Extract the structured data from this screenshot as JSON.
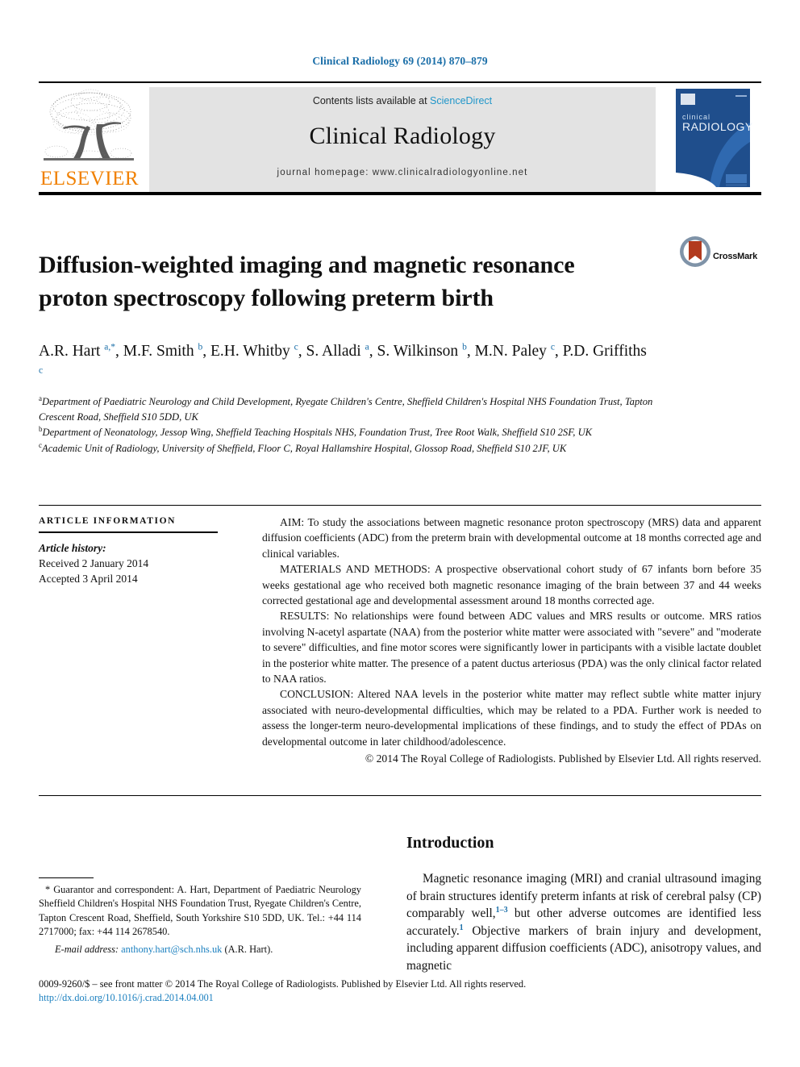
{
  "running_head": "Clinical Radiology 69 (2014) 870–879",
  "masthead": {
    "publisher_name": "ELSEVIER",
    "publisher_logo_icon": "elsevier-tree-icon",
    "contents_prefix": "Contents lists available at ",
    "contents_link": "ScienceDirect",
    "journal_name": "Clinical Radiology",
    "homepage_line": "journal homepage: www.clinicalradiologyonline.net",
    "cover_icon": "journal-cover-thumbnail",
    "cover_title_small": "clinical",
    "cover_title_large": "RADIOLOGY"
  },
  "crossmark": {
    "label": "CrossMark",
    "icon": "crossmark-badge-icon"
  },
  "article": {
    "title": "Diffusion-weighted imaging and magnetic resonance proton spectroscopy following preterm birth",
    "authors_html": "A.R. Hart <sup>a,*</sup>, M.F. Smith <sup>b</sup>, E.H. Whitby <sup>c</sup>, S. Alladi <sup>a</sup>, S. Wilkinson <sup>b</sup>, M.N. Paley <sup>c</sup>, P.D. Griffiths <sup>c</sup>",
    "affiliations": [
      {
        "marker": "a",
        "text": "Department of Paediatric Neurology and Child Development, Ryegate Children's Centre, Sheffield Children's Hospital NHS Foundation Trust, Tapton Crescent Road, Sheffield S10 5DD, UK"
      },
      {
        "marker": "b",
        "text": "Department of Neonatology, Jessop Wing, Sheffield Teaching Hospitals NHS, Foundation Trust, Tree Root Walk, Sheffield S10 2SF, UK"
      },
      {
        "marker": "c",
        "text": "Academic Unit of Radiology, University of Sheffield, Floor C, Royal Hallamshire Hospital, Glossop Road, Sheffield S10 2JF, UK"
      }
    ]
  },
  "article_info": {
    "heading": "ARTICLE INFORMATION",
    "history_label": "Article history:",
    "received": "Received 2 January 2014",
    "accepted": "Accepted 3 April 2014"
  },
  "abstract": {
    "aim": "AIM: To study the associations between magnetic resonance proton spectroscopy (MRS) data and apparent diffusion coefficients (ADC) from the preterm brain with developmental outcome at 18 months corrected age and clinical variables.",
    "methods": "MATERIALS AND METHODS: A prospective observational cohort study of 67 infants born before 35 weeks gestational age who received both magnetic resonance imaging of the brain between 37 and 44 weeks corrected gestational age and developmental assessment around 18 months corrected age.",
    "results": "RESULTS: No relationships were found between ADC values and MRS results or outcome. MRS ratios involving N-acetyl aspartate (NAA) from the posterior white matter were associated with \"severe\" and \"moderate to severe\" difficulties, and fine motor scores were significantly lower in participants with a visible lactate doublet in the posterior white matter. The presence of a patent ductus arteriosus (PDA) was the only clinical factor related to NAA ratios.",
    "conclusion": "CONCLUSION: Altered NAA levels in the posterior white matter may reflect subtle white matter injury associated with neuro-developmental difficulties, which may be related to a PDA. Further work is needed to assess the longer-term neuro-developmental implications of these findings, and to study the effect of PDAs on developmental outcome in later childhood/adolescence.",
    "copyright": "© 2014 The Royal College of Radiologists. Published by Elsevier Ltd. All rights reserved."
  },
  "introduction": {
    "heading": "Introduction",
    "paragraph_html": "Magnetic resonance imaging (MRI) and cranial ultrasound imaging of brain structures identify preterm infants at risk of cerebral palsy (CP) comparably well,<sup>1&#8211;3</sup> but other adverse outcomes are identified less accurately.<sup>1</sup> Objective markers of brain injury and development, including apparent diffusion coefficients (ADC), anisotropy values, and magnetic"
  },
  "footnote": {
    "correspondence": "* Guarantor and correspondent: A. Hart, Department of Paediatric Neurology Sheffield Children's Hospital NHS Foundation Trust, Ryegate Children's Centre, Tapton Crescent Road, Sheffield, South Yorkshire S10 5DD, UK. Tel.: +44 114 2717000; fax: +44 114 2678540.",
    "email_label": "E-mail address:",
    "email_address": "anthony.hart@sch.nhs.uk",
    "email_suffix": "(A.R. Hart)."
  },
  "bottom": {
    "issn_line": "0009-9260/$ – see front matter © 2014 The Royal College of Radiologists. Published by Elsevier Ltd. All rights reserved.",
    "doi_line": "http://dx.doi.org/10.1016/j.crad.2014.04.001"
  },
  "colors": {
    "link_blue": "#1a7fbf",
    "sciencedirect_blue": "#2196c9",
    "elsevier_orange": "#f08000",
    "crossmark_red": "#b23a1e",
    "cover_blue": "#1f4e8c"
  }
}
